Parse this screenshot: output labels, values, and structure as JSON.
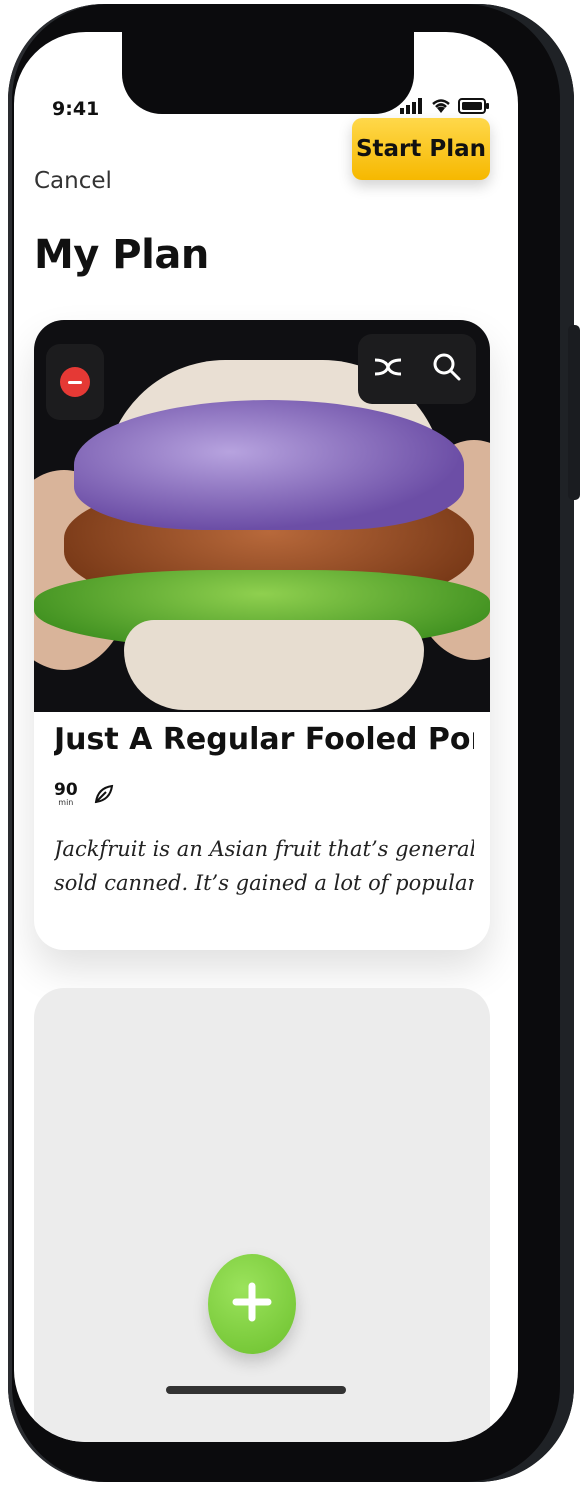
{
  "status_bar": {
    "time": "9:41"
  },
  "nav": {
    "cancel_label": "Cancel",
    "start_label": "Start Plan"
  },
  "page": {
    "title": "My Plan"
  },
  "recipe": {
    "title": "Just A Regular Fooled Pork S",
    "minutes": "90",
    "minutes_unit": "min",
    "description_line1": "Jackfruit is an Asian fruit that’s generally",
    "description_line2": "sold canned. It’s gained a lot of popularity",
    "icons": [
      "remove-icon",
      "shuffle-icon",
      "search-icon",
      "leaf-icon"
    ]
  },
  "fab": {
    "icon": "plus-icon"
  },
  "colors": {
    "accent_yellow": "#f6b800",
    "fab_green": "#7ccd3a",
    "remove_red": "#e53935"
  }
}
